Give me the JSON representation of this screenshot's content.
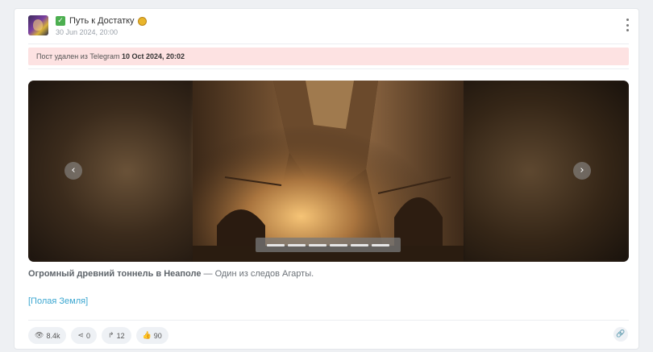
{
  "post": {
    "channel_name": "Путь к Достатку",
    "date": "30 Jun 2024, 20:00",
    "deleted_notice": "Пост удален из Telegram",
    "deleted_date": "10 Oct 2024, 20:02",
    "caption_bold": "Огромный древний тоннель в Неаполе",
    "caption_rest": " — Один из следов Агарты.",
    "tag": "[Полая Земля]"
  },
  "gallery": {
    "slide_count": 6,
    "active_slide": 4,
    "prev_icon": "chevron-left-icon",
    "next_icon": "chevron-right-icon"
  },
  "stats": {
    "views": "8.4k",
    "shares": "0",
    "forwards": "12",
    "likes": "90"
  },
  "colors": {
    "deleted_bg": "#fde2e2",
    "tag_link": "#3aa6d0",
    "verified_check": "#4caf50"
  }
}
